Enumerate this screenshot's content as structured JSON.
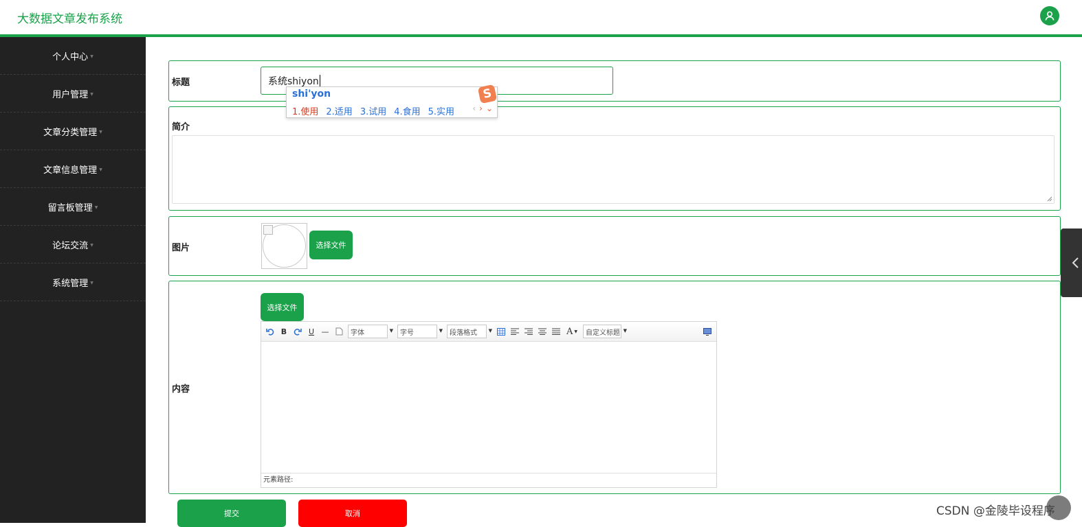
{
  "header": {
    "title": "大数据文章发布系统",
    "user_icon": "user-icon"
  },
  "sidebar": {
    "items": [
      {
        "label": "个人中心"
      },
      {
        "label": "用户管理"
      },
      {
        "label": "文章分类管理"
      },
      {
        "label": "文章信息管理"
      },
      {
        "label": "留言板管理"
      },
      {
        "label": "论坛交流"
      },
      {
        "label": "系统管理"
      }
    ]
  },
  "form": {
    "title_label": "标题",
    "title_value": "系统shiyon",
    "intro_label": "简介",
    "image_label": "图片",
    "image_button": "选择文件",
    "content_label": "内容",
    "content_button": "选择文件",
    "submit_label": "提交",
    "cancel_label": "取消"
  },
  "ime": {
    "pinyin": "shi'yon",
    "candidates": [
      "1.使用",
      "2.适用",
      "3.试用",
      "4.食用",
      "5.实用"
    ],
    "logo": "S"
  },
  "editor": {
    "font_select": "字体",
    "size_select": "字号",
    "paragraph_select": "段落格式",
    "custom_title_select": "自定义标题",
    "bold": "B",
    "underline": "U",
    "font_color": "A",
    "element_path": "元素路径:"
  },
  "watermark": "CSDN @金陵毕设程序",
  "colors": {
    "accent": "#1aa14a",
    "sidebar": "#222222",
    "cancel": "#ff0000"
  }
}
